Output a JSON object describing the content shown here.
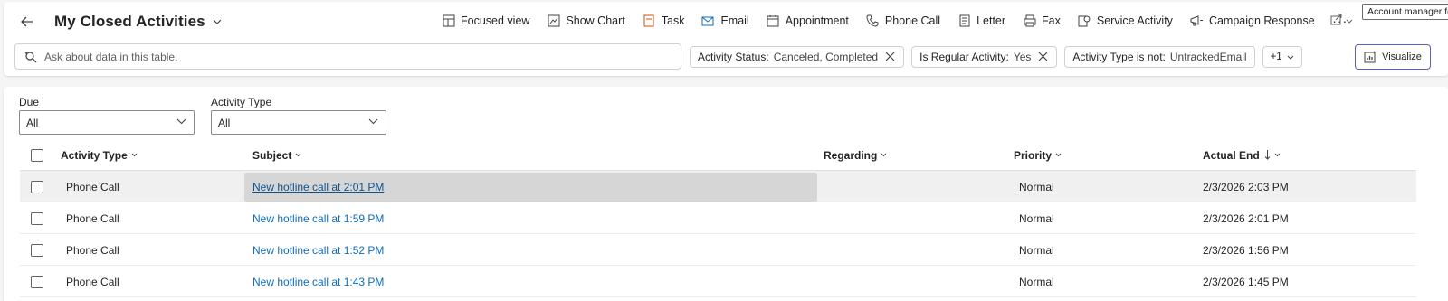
{
  "header": {
    "title": "My Closed Activities",
    "tooltip": "Account manager fo"
  },
  "commands": [
    {
      "label": "Focused view",
      "icon": "focused-view-icon"
    },
    {
      "label": "Show Chart",
      "icon": "chart-icon"
    },
    {
      "label": "Task",
      "icon": "task-icon"
    },
    {
      "label": "Email",
      "icon": "email-icon"
    },
    {
      "label": "Appointment",
      "icon": "calendar-icon"
    },
    {
      "label": "Phone Call",
      "icon": "phone-icon"
    },
    {
      "label": "Letter",
      "icon": "letter-icon"
    },
    {
      "label": "Fax",
      "icon": "fax-icon"
    },
    {
      "label": "Service Activity",
      "icon": "service-activity-icon"
    },
    {
      "label": "Campaign Response",
      "icon": "campaign-response-icon"
    }
  ],
  "more_label": "···",
  "search": {
    "placeholder": "Ask about data in this table."
  },
  "filter_chips": [
    {
      "label": "Activity Status:",
      "value": "Canceled, Completed"
    },
    {
      "label": "Is Regular Activity:",
      "value": "Yes"
    },
    {
      "label": "Activity Type is not:",
      "value": "UntrackedEmail"
    }
  ],
  "more_filters_label": "+1",
  "visualize_label": "Visualize",
  "filters": {
    "due": {
      "label": "Due",
      "value": "All"
    },
    "activity_type": {
      "label": "Activity Type",
      "value": "All"
    }
  },
  "columns": {
    "activity_type": "Activity Type",
    "subject": "Subject",
    "regarding": "Regarding",
    "priority": "Priority",
    "actual_end": "Actual End"
  },
  "rows": [
    {
      "activity_type": "Phone Call",
      "subject": "New hotline call at 2:01 PM",
      "regarding": "",
      "priority": "Normal",
      "actual_end": "2/3/2026 2:03 PM"
    },
    {
      "activity_type": "Phone Call",
      "subject": "New hotline call at 1:59 PM",
      "regarding": "",
      "priority": "Normal",
      "actual_end": "2/3/2026 2:01 PM"
    },
    {
      "activity_type": "Phone Call",
      "subject": "New hotline call at 1:52 PM",
      "regarding": "",
      "priority": "Normal",
      "actual_end": "2/3/2026 1:56 PM"
    },
    {
      "activity_type": "Phone Call",
      "subject": "New hotline call at 1:43 PM",
      "regarding": "",
      "priority": "Normal",
      "actual_end": "2/3/2026 1:45 PM"
    }
  ],
  "colors": {
    "link": "#0f6cbd",
    "accent": "#5b5fc7"
  }
}
